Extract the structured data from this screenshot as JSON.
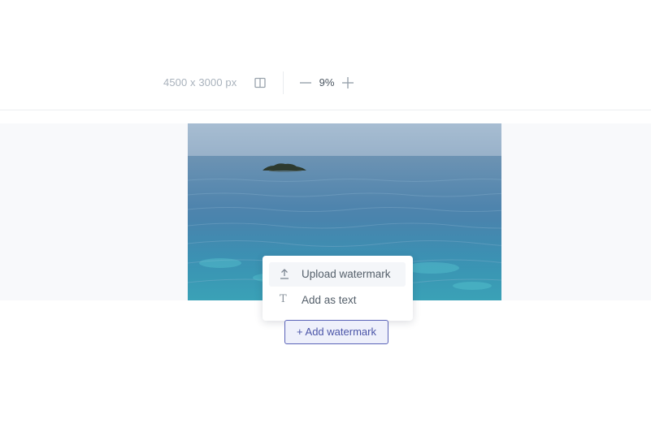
{
  "toolbar": {
    "dimensions": "4500 x 3000 px",
    "compare_icon": "split-view-icon",
    "zoom_out_icon": "minus-icon",
    "zoom_value": "9%",
    "zoom_in_icon": "plus-icon"
  },
  "preview": {
    "image_subject": "calm sea with small rock island"
  },
  "watermark_menu": {
    "items": [
      {
        "label": "Upload watermark",
        "icon": "upload-icon"
      },
      {
        "label": "Add as text",
        "icon": "text-icon"
      }
    ]
  },
  "add_button": {
    "label": "+ Add watermark"
  },
  "colors": {
    "accent": "#5a63b8",
    "accent_bg": "#eef0fb",
    "muted_text": "#a9b2bc",
    "preview_bg": "#f8f9fb"
  }
}
